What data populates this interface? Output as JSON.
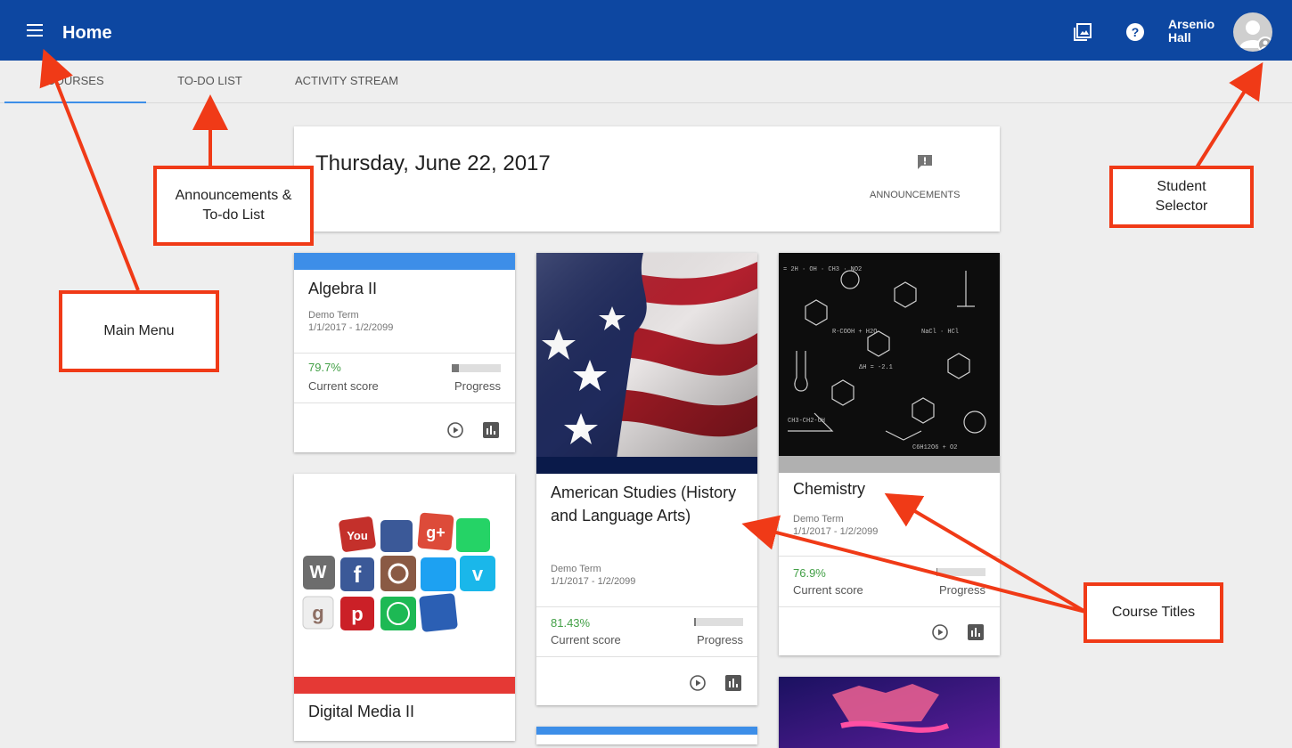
{
  "appbar": {
    "title": "Home",
    "user_first": "Arsenio",
    "user_last": "Hall",
    "icons": [
      "menu-icon",
      "gallery-icon",
      "help-icon",
      "avatar"
    ]
  },
  "tabs": [
    {
      "label": "COURSES",
      "active": true
    },
    {
      "label": "TO-DO LIST",
      "active": false
    },
    {
      "label": "ACTIVITY STREAM",
      "active": false
    }
  ],
  "header_card": {
    "date": "Thursday, June 22, 2017",
    "announcements_label": "ANNOUNCEMENTS"
  },
  "courses": [
    {
      "title": "Algebra II",
      "term": "Demo Term",
      "dates": "1/1/2017 - 1/2/2099",
      "score": "79.7%",
      "score_label": "Current score",
      "progress_label": "Progress",
      "progress": 0.15,
      "accent": "#3d8ee8"
    },
    {
      "title": "American Studies (History and Language Arts)",
      "term": "Demo Term",
      "dates": "1/1/2017 - 1/2/2099",
      "score": "81.43%",
      "score_label": "Current score",
      "progress_label": "Progress",
      "progress": 0.03,
      "accent": "#0a1a4a"
    },
    {
      "title": "Chemistry",
      "term": "Demo Term",
      "dates": "1/1/2017 - 1/2/2099",
      "score": "76.9%",
      "score_label": "Current score",
      "progress_label": "Progress",
      "progress": 0.02,
      "accent": "#b0b0b0"
    },
    {
      "title": "Digital Media II",
      "accent": "#e53935"
    }
  ],
  "annotations": {
    "main_menu": "Main Menu",
    "announcements_todo": "Announcements & To-do List",
    "student_selector": "Student Selector",
    "course_titles": "Course Titles"
  },
  "colors": {
    "appbar": "#0d47a1",
    "score_green": "#43a047",
    "annotation_red": "#f03a17",
    "tab_indicator": "#3d8ee8"
  }
}
